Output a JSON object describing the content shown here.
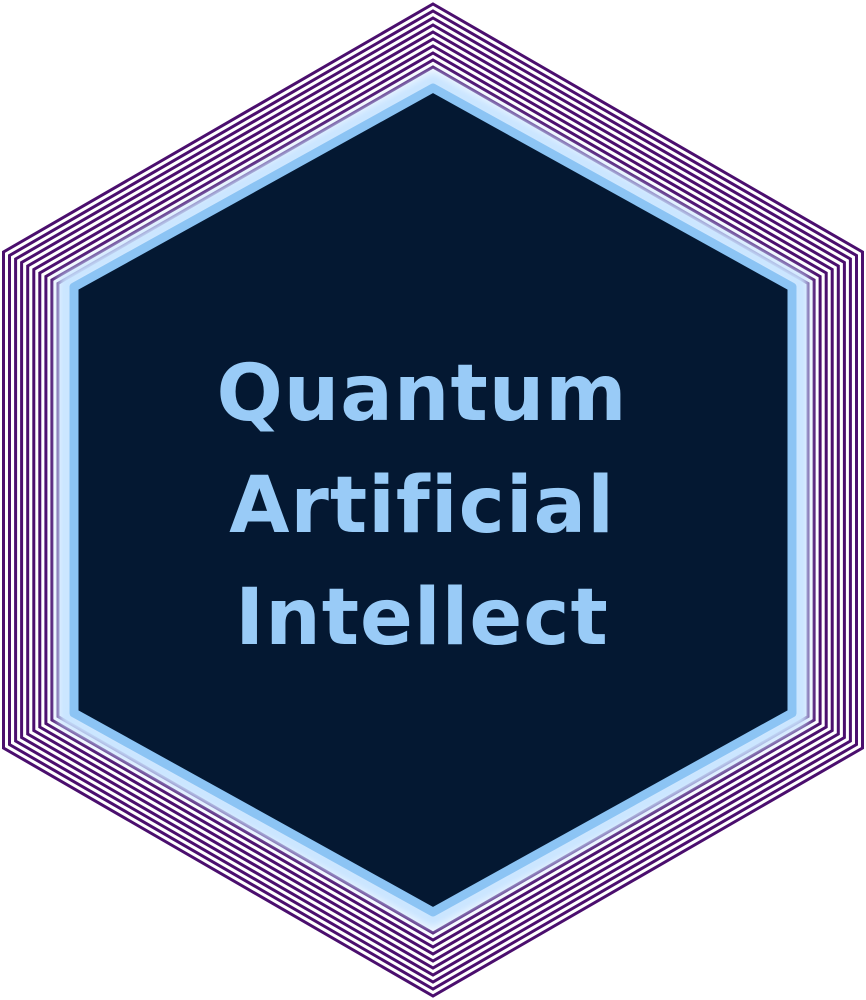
{
  "logo": {
    "lines": [
      "Quantum",
      "Artificial",
      "Intellect"
    ]
  },
  "colors": {
    "background": "#ffffff",
    "outer_rings": "#4b0f6e",
    "glow": "#c8e4ff",
    "inner_border": "#8cc4f4",
    "inner_fill": "#041832",
    "text": "#99cbf7"
  },
  "icon": "hexagon-badge"
}
